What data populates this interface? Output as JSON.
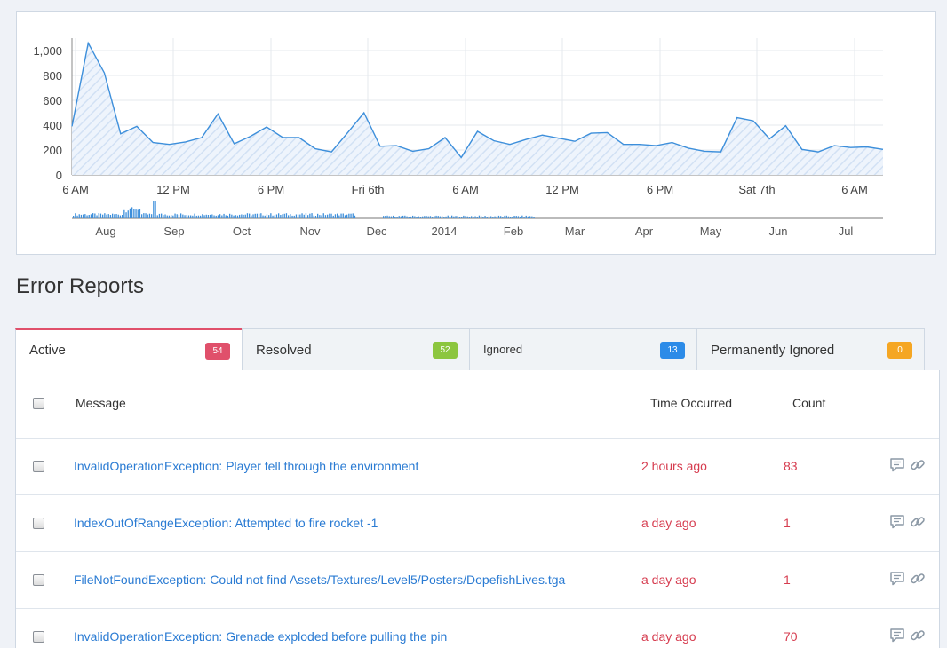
{
  "chart_data": {
    "type": "area",
    "y_ticks": [
      "1,000",
      "800",
      "600",
      "400",
      "200",
      "0"
    ],
    "ylim": [
      0,
      1100
    ],
    "grid": true,
    "x_tick_labels": [
      "6 AM",
      "12 PM",
      "6 PM",
      "Fri 6th",
      "6 AM",
      "12 PM",
      "6 PM",
      "Sat 7th",
      "6 AM"
    ],
    "series": [
      {
        "values": [
          390,
          1060,
          820,
          330,
          390,
          260,
          245,
          265,
          300,
          490,
          250,
          310,
          385,
          300,
          300,
          210,
          185,
          340,
          500,
          230,
          235,
          190,
          210,
          300,
          140,
          350,
          275,
          245,
          285,
          320,
          295,
          270,
          335,
          340,
          245,
          245,
          235,
          260,
          215,
          190,
          185,
          460,
          435,
          290,
          395,
          205,
          185,
          235,
          220,
          225,
          205
        ]
      }
    ],
    "navigator": {
      "month_labels": [
        "Aug",
        "Sep",
        "Oct",
        "Nov",
        "Dec",
        "2014",
        "Feb",
        "Mar",
        "Apr",
        "May",
        "Jun",
        "Jul"
      ]
    }
  },
  "section": {
    "title": "Error Reports"
  },
  "tabs": [
    {
      "label": "Active",
      "count": "54",
      "color": "#e0506b"
    },
    {
      "label": "Resolved",
      "count": "52",
      "color": "#8cc63f"
    },
    {
      "label": "Ignored",
      "count": "13",
      "color": "#2c8be8"
    },
    {
      "label": "Permanently Ignored",
      "count": "0",
      "color": "#f5a623"
    }
  ],
  "table": {
    "headers": {
      "message": "Message",
      "time": "Time Occurred",
      "count": "Count"
    },
    "rows": [
      {
        "message": "InvalidOperationException: Player fell through the environment",
        "time": "2 hours ago",
        "count": "83"
      },
      {
        "message": "IndexOutOfRangeException: Attempted to fire rocket -1",
        "time": "a day ago",
        "count": "1"
      },
      {
        "message": "FileNotFoundException: Could not find Assets/Textures/Level5/Posters/DopefishLives.tga",
        "time": "a day ago",
        "count": "1"
      },
      {
        "message": "InvalidOperationException: Grenade exploded before pulling the pin",
        "time": "a day ago",
        "count": "70"
      }
    ]
  },
  "icons": {
    "comment": "comment-icon",
    "link": "link-icon"
  }
}
